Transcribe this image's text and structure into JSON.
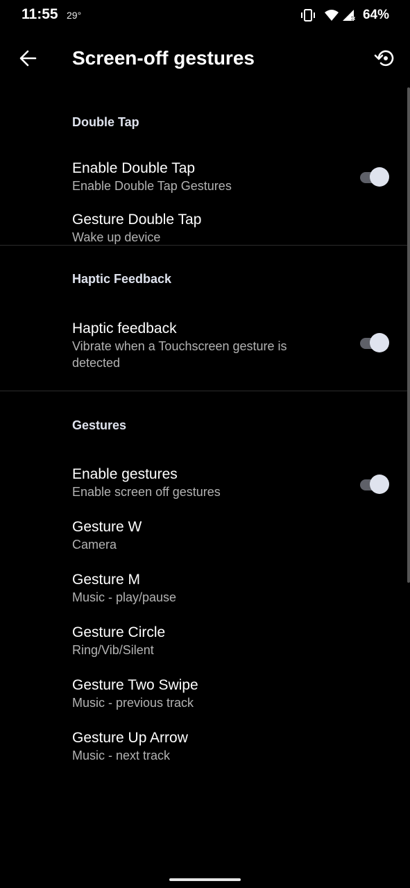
{
  "status_bar": {
    "time": "11:55",
    "temperature": "29°",
    "battery": "64%",
    "icons": [
      "vibrate-icon",
      "wifi-icon",
      "signal-icon"
    ]
  },
  "app_bar": {
    "title": "Screen-off gestures",
    "back_icon": "arrow-back-icon",
    "reset_icon": "restore-icon"
  },
  "categories": [
    {
      "title": "Double Tap",
      "items": [
        {
          "title": "Enable Double Tap",
          "summary": "Enable Double Tap Gestures",
          "switch": true,
          "checked": true
        },
        {
          "title": "Gesture Double Tap",
          "summary": "Wake up device"
        }
      ]
    },
    {
      "title": "Haptic Feedback",
      "items": [
        {
          "title": "Haptic feedback",
          "summary_line1": "Vibrate when a Touchscreen gesture is",
          "summary_line2": "detected",
          "switch": true,
          "checked": true
        }
      ]
    },
    {
      "title": "Gestures",
      "items": [
        {
          "title": "Enable gestures",
          "summary": "Enable screen off gestures",
          "switch": true,
          "checked": true
        },
        {
          "title": "Gesture W",
          "summary": "Camera"
        },
        {
          "title": "Gesture M",
          "summary": "Music - play/pause"
        },
        {
          "title": "Gesture Circle",
          "summary": "Ring/Vib/Silent"
        },
        {
          "title": "Gesture Two Swipe",
          "summary": "Music - previous track"
        },
        {
          "title": "Gesture Up Arrow",
          "summary": "Music - next track"
        }
      ]
    }
  ],
  "colors": {
    "background": "#000000",
    "category_title": "#dfe3ee",
    "summary": "#b3b3b3",
    "switch_thumb": "#dfe3ee",
    "switch_track": "#5e6068"
  }
}
